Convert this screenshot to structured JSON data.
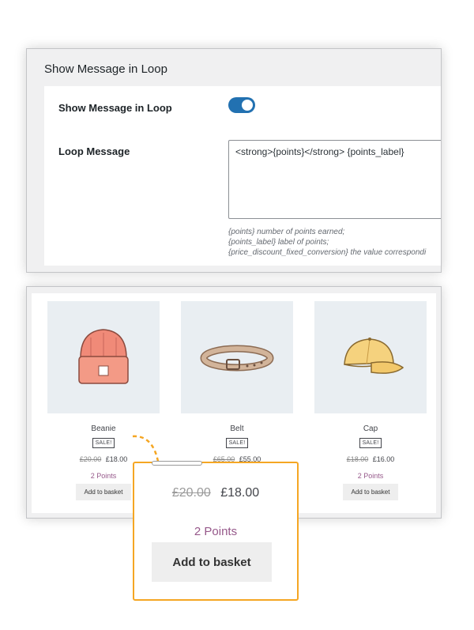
{
  "settings": {
    "title": "Show Message in Loop",
    "toggle_label": "Show Message in Loop",
    "toggle_on": true,
    "loop_message_label": "Loop Message",
    "loop_message_value": "<strong>{points}</strong> {points_label}",
    "help_lines": [
      "{points} number of points earned;",
      "{points_label} label of points;",
      "{price_discount_fixed_conversion} the value correspondi"
    ]
  },
  "products": [
    {
      "name": "Beanie",
      "badge": "SALE!",
      "old_price": "£20.00",
      "price": "£18.00",
      "points": "2 Points",
      "button": "Add to basket",
      "icon": "beanie-icon"
    },
    {
      "name": "Belt",
      "badge": "SALE!",
      "old_price": "£65.00",
      "price": "£55.00",
      "points": "",
      "button": "",
      "icon": "belt-icon"
    },
    {
      "name": "Cap",
      "badge": "SALE!",
      "old_price": "£18.00",
      "price": "£16.00",
      "points": "2 Points",
      "button": "Add to basket",
      "icon": "cap-icon"
    }
  ],
  "zoom": {
    "old_price": "£20.00",
    "price": "£18.00",
    "points": "2 Points",
    "button": "Add to basket"
  },
  "colors": {
    "toggle": "#2271b1",
    "points": "#96588a",
    "callout_border": "#f5a623"
  }
}
